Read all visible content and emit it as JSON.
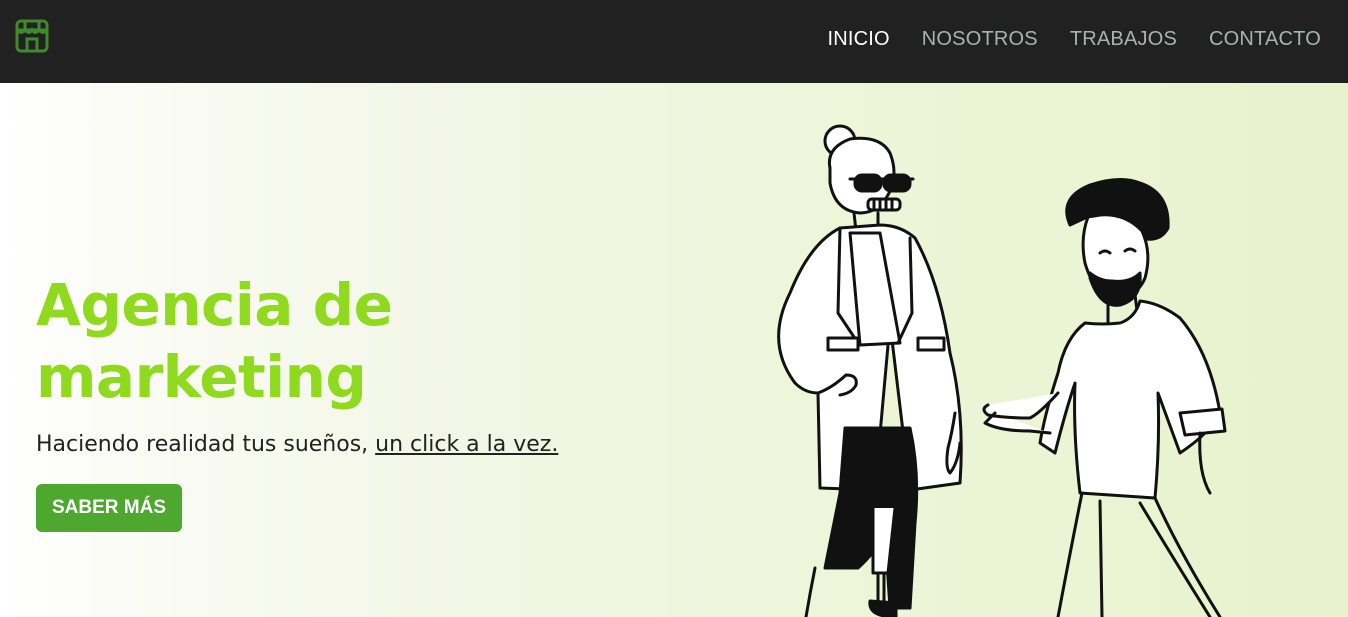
{
  "header": {
    "logo_icon": "storefront-icon",
    "nav": [
      {
        "label": "INICIO",
        "active": true
      },
      {
        "label": "NOSOTROS",
        "active": false
      },
      {
        "label": "TRABAJOS",
        "active": false
      },
      {
        "label": "CONTACTO",
        "active": false
      }
    ]
  },
  "hero": {
    "title_line1": "Agencia de",
    "title_line2": "marketing",
    "subtitle_text": "Haciendo realidad tus sueños, ",
    "subtitle_link": "un click a la vez.",
    "cta_label": "SABER MÁS",
    "illustration": "two-people-walking-illustration"
  },
  "colors": {
    "navbar_bg": "#212121",
    "accent_title": "#8fd91e",
    "button_bg": "#4ea72e",
    "logo_green": "#3f8a2c",
    "nav_active": "#ffffff",
    "nav_inactive": "#a9b3b0"
  }
}
